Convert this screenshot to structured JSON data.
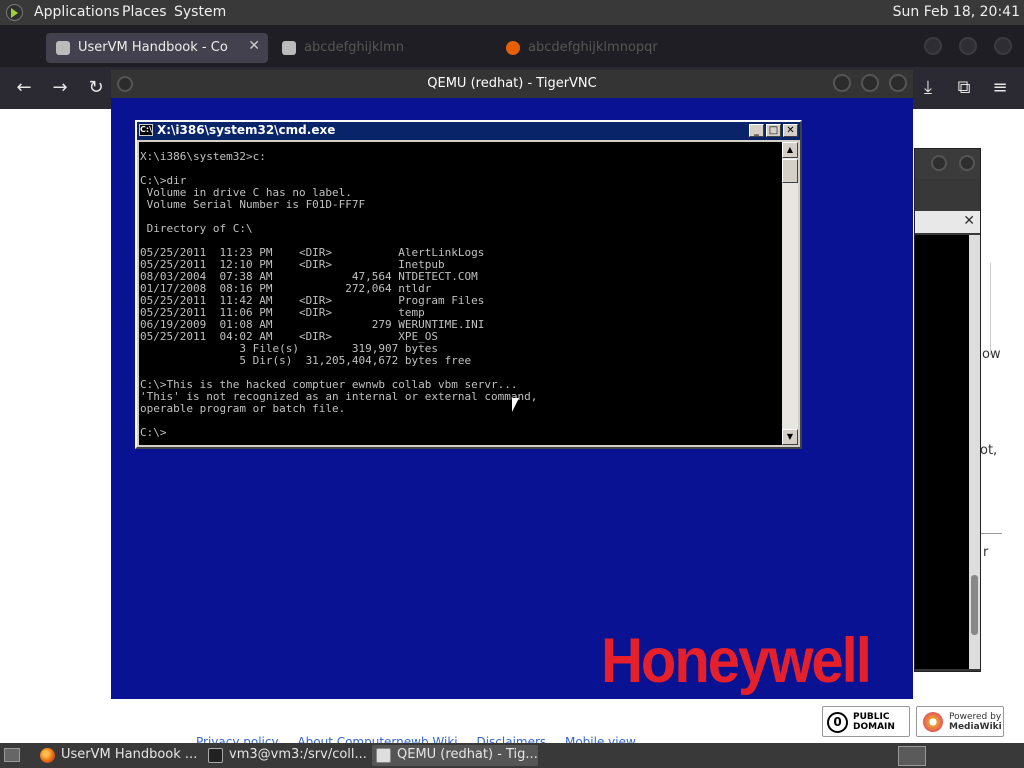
{
  "top_panel": {
    "menus": [
      "Applications",
      "Places",
      "System"
    ],
    "clock": "Sun Feb 18, 20:41"
  },
  "browser": {
    "tabs": [
      {
        "label": "UserVM Handbook - Compu",
        "close": "✕"
      },
      {
        "label": "abcdefghijklmn",
        "close": ""
      },
      {
        "label": "abcdefghijklmnopqr",
        "close": ""
      }
    ],
    "nav": {
      "back": "←",
      "forward": "→",
      "reload": "↻",
      "download": "⤓",
      "extensions": "⧉",
      "menu": "≡"
    },
    "page_fragments": {
      "now": "now",
      "ow": "ow",
      "ot": "ot,",
      "r": "r"
    },
    "footer_links": [
      "Privacy policy",
      "About Computernewb Wiki",
      "Disclaimers",
      "Mobile view"
    ],
    "badges": {
      "public_domain": {
        "line1": "PUBLIC",
        "line2": "DOMAIN",
        "glyph": "0"
      },
      "mediawiki": {
        "line1": "Powered by",
        "line2": "MediaWiki"
      }
    }
  },
  "qemu": {
    "title": "QEMU (redhat) - TigerVNC",
    "cmd": {
      "title": "X:\\i386\\system32\\cmd.exe",
      "icon_text": "C:\\",
      "buttons": {
        "minimize": "_",
        "maximize": "□",
        "close": "✕"
      },
      "console": "X:\\i386\\system32>c:\n\nC:\\>dir\n Volume in drive C has no label.\n Volume Serial Number is F01D-FF7F\n\n Directory of C:\\\n\n05/25/2011  11:23 PM    <DIR>          AlertLinkLogs\n05/25/2011  12:10 PM    <DIR>          Inetpub\n08/03/2004  07:38 AM            47,564 NTDETECT.COM\n01/17/2008  08:16 PM           272,064 ntldr\n05/25/2011  11:42 AM    <DIR>          Program Files\n05/25/2011  11:06 PM    <DIR>          temp\n06/19/2009  01:08 AM               279 WERUNTIME.INI\n05/25/2011  04:02 AM    <DIR>          XPE_OS\n               3 File(s)        319,907 bytes\n               5 Dir(s)  31,205,404,672 bytes free\n\nC:\\>This is the hacked comptuer ewnwb collab vbm servr...\n'This' is not recognized as an internal or external command,\noperable program or batch file.\n\nC:\\>"
    },
    "logo": "Honeywell"
  },
  "taskbar": {
    "items": [
      {
        "label": "UserVM Handbook ...",
        "icon": "firefox-icon"
      },
      {
        "label": "vm3@vm3:/srv/coll...",
        "icon": "terminal-icon"
      },
      {
        "label": "QEMU (redhat) - Tig...",
        "icon": "vnc-icon"
      }
    ]
  },
  "colors": {
    "vm_background": "#0a1294",
    "cmd_titlebar": "#0a246a",
    "honeywell_red": "#e5202b",
    "panel": "#393939"
  }
}
